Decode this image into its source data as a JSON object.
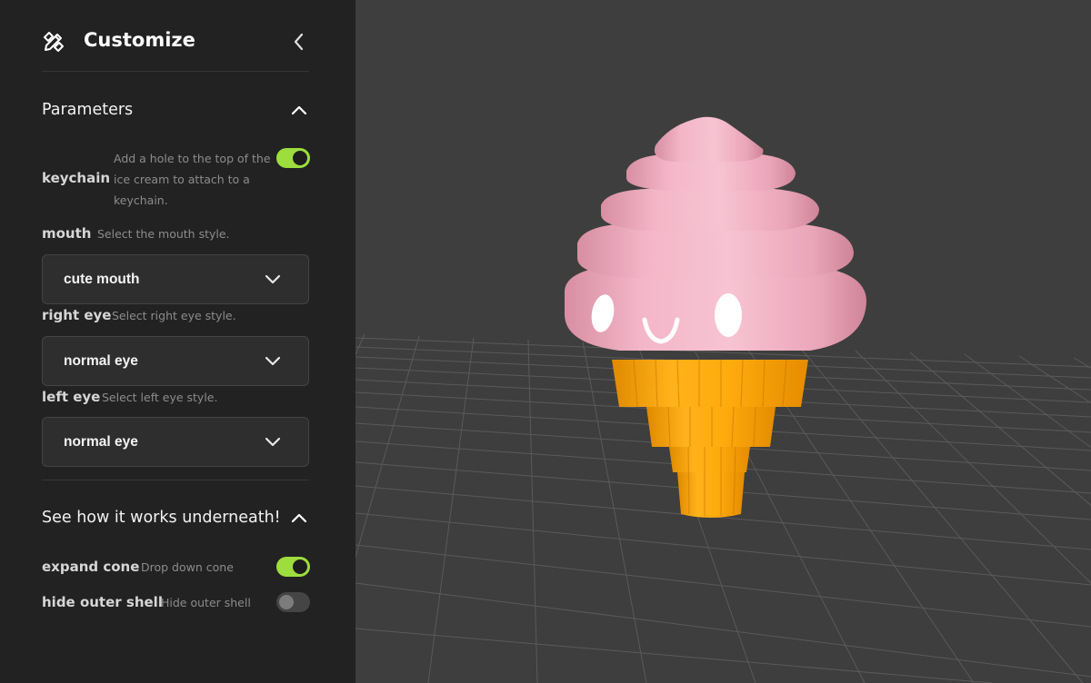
{
  "panel": {
    "title": "Customize",
    "header_icon": "tools-icon",
    "collapse_icon": "chevron-left-icon"
  },
  "sections": {
    "parameters": {
      "label": "Parameters",
      "expanded": true
    },
    "underneath": {
      "label": "See how it works underneath!",
      "expanded": true
    }
  },
  "params": {
    "keychain": {
      "name": "keychain",
      "description": "Add a hole to the top of the ice cream to attach to a keychain.",
      "enabled": true
    },
    "mouth": {
      "name": "mouth",
      "description": "Select the mouth style.",
      "value": "cute mouth"
    },
    "right_eye": {
      "name": "right eye",
      "description": "Select right eye style.",
      "value": "normal eye"
    },
    "left_eye": {
      "name": "left eye",
      "description": "Select left eye style.",
      "value": "normal eye"
    },
    "expand_cone": {
      "name": "expand cone",
      "description": "Drop down cone",
      "enabled": true
    },
    "hide_outer_shell": {
      "name": "hide outer shell",
      "description": "Hide outer shell",
      "enabled": false
    }
  },
  "colors": {
    "sidebar_bg": "#222222",
    "viewport_bg": "#3e3e3e",
    "accent_toggle": "#9ddd3e",
    "ice_cream_pink": "#f2b5c8",
    "cone_orange": "#ffa80a"
  }
}
